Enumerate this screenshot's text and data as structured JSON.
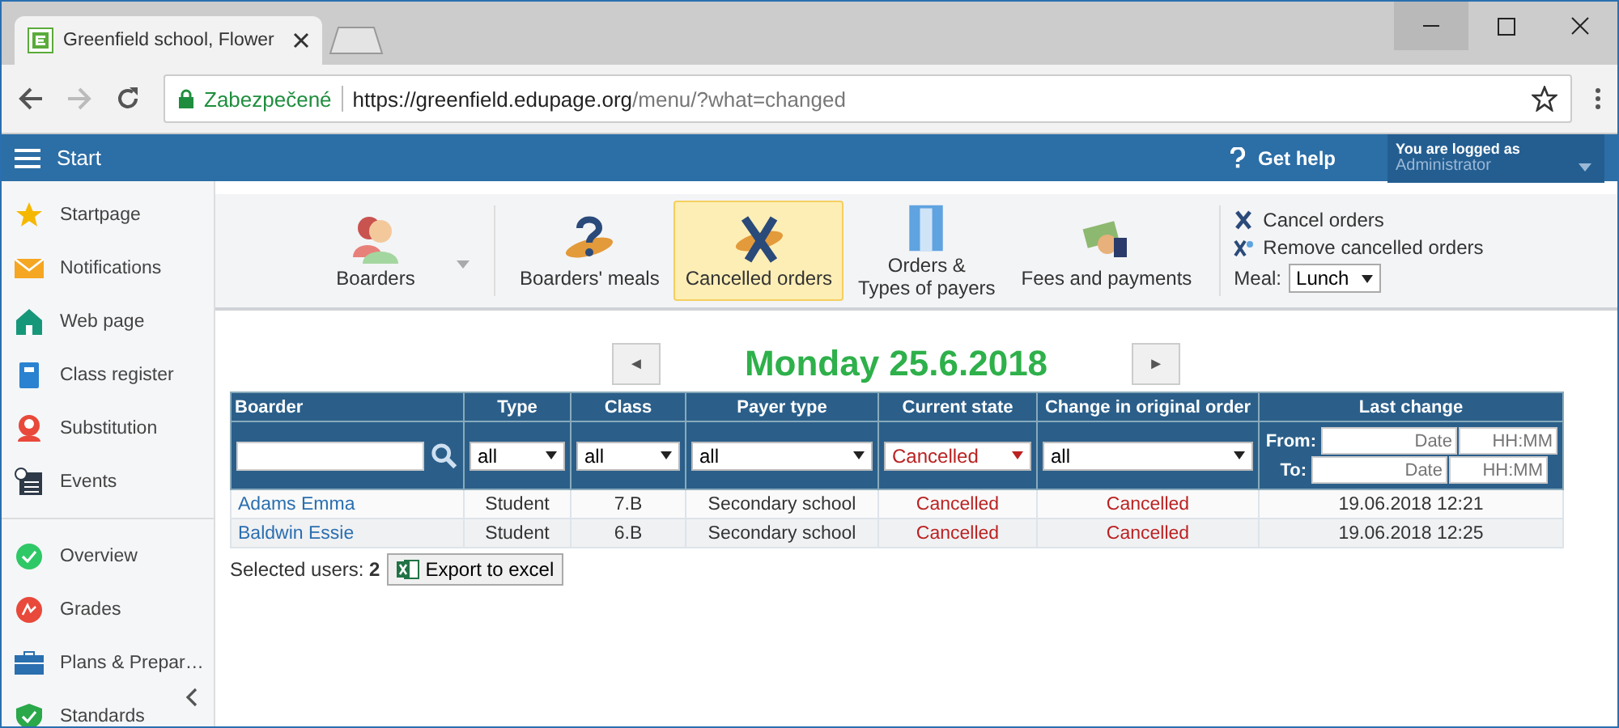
{
  "browser": {
    "tab_title": "Greenfield school, Flower",
    "secure_label": "Zabezpečené",
    "url_host": "https://greenfield.edupage.org",
    "url_path": "/menu/?what=changed"
  },
  "app_bar": {
    "menu_label": "Start",
    "help_label": "Get help",
    "login_caption": "You are logged as",
    "login_user": "Administrator"
  },
  "sidebar": {
    "groups": [
      [
        {
          "label": "Startpage"
        },
        {
          "label": "Notifications"
        },
        {
          "label": "Web page"
        },
        {
          "label": "Class register"
        },
        {
          "label": "Substitution"
        },
        {
          "label": "Events"
        }
      ],
      [
        {
          "label": "Overview"
        },
        {
          "label": "Grades"
        },
        {
          "label": "Plans & Prepar…"
        },
        {
          "label": "Standards"
        }
      ]
    ]
  },
  "ribbon": {
    "items": [
      {
        "label": "Boarders",
        "dropdown": true,
        "selected": false
      },
      {
        "label": "Boarders' meals",
        "dropdown": false,
        "selected": false
      },
      {
        "label": "Cancelled orders",
        "dropdown": false,
        "selected": true
      },
      {
        "label": "Orders &\nTypes of payers",
        "dropdown": false,
        "selected": false
      },
      {
        "label": "Fees and payments",
        "dropdown": false,
        "selected": false
      }
    ],
    "actions": [
      {
        "label": "Cancel orders"
      },
      {
        "label": "Remove cancelled orders"
      }
    ],
    "meal": {
      "label": "Meal:",
      "value": "Lunch"
    }
  },
  "date_nav": {
    "prev": "◄",
    "title": "Monday 25.6.2018",
    "next": "►"
  },
  "table": {
    "columns": [
      "Boarder",
      "Type",
      "Class",
      "Payer type",
      "Current state",
      "Change in original order",
      "Last change"
    ],
    "filters": {
      "type": "all",
      "class": "all",
      "payer_type": "all",
      "current_state": "Cancelled",
      "change": "all",
      "from_label": "From:",
      "from_date_placeholder": "Date",
      "from_time_placeholder": "HH:MM",
      "to_label": "To:",
      "to_date_placeholder": "Date",
      "to_time_placeholder": "HH:MM"
    },
    "rows": [
      {
        "boarder": "Adams Emma",
        "type": "Student",
        "class": "7.B",
        "payer_type": "Secondary school",
        "current_state": "Cancelled",
        "change": "Cancelled",
        "last_change": "19.06.2018 12:21"
      },
      {
        "boarder": "Baldwin Essie",
        "type": "Student",
        "class": "6.B",
        "payer_type": "Secondary school",
        "current_state": "Cancelled",
        "change": "Cancelled",
        "last_change": "19.06.2018 12:25"
      }
    ]
  },
  "footer": {
    "selected_label": "Selected users:",
    "selected_count": "2",
    "export_label": "Export to excel"
  }
}
